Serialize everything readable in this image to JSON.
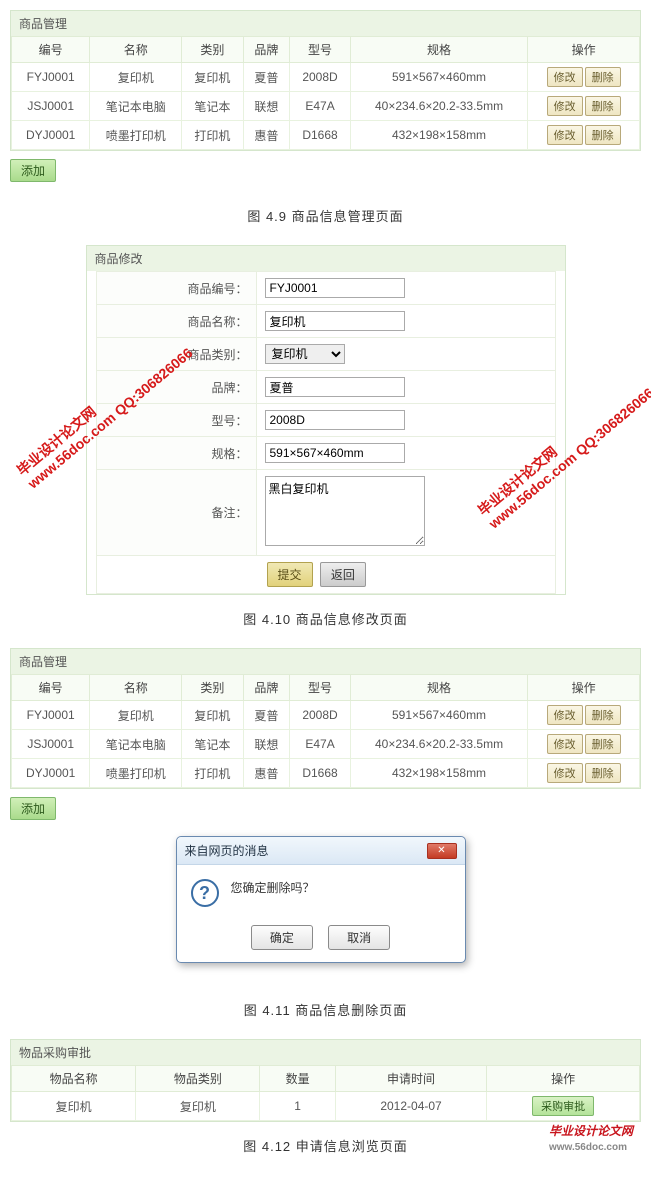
{
  "colors": {
    "border": "#d5e6cc",
    "accent": "#a9db8c",
    "danger": "#c43b24"
  },
  "table1": {
    "title": "商品管理",
    "headers": [
      "编号",
      "名称",
      "类别",
      "品牌",
      "型号",
      "规格",
      "操作"
    ],
    "rows": [
      {
        "no": "FYJ0001",
        "name": "复印机",
        "cat": "复印机",
        "brand": "夏普",
        "model": "2008D",
        "spec": "591×567×460mm"
      },
      {
        "no": "JSJ0001",
        "name": "笔记本电脑",
        "cat": "笔记本",
        "brand": "联想",
        "model": "E47A",
        "spec": "40×234.6×20.2-33.5mm"
      },
      {
        "no": "DYJ0001",
        "name": "喷墨打印机",
        "cat": "打印机",
        "brand": "惠普",
        "model": "D1668",
        "spec": "432×198×158mm"
      }
    ],
    "edit": "修改",
    "del": "删除",
    "add": "添加"
  },
  "caption1": "图 4.9 商品信息管理页面",
  "form": {
    "title": "商品修改",
    "fields": {
      "no_label": "商品编号：",
      "no_value": "FYJ0001",
      "name_label": "商品名称：",
      "name_value": "复印机",
      "cat_label": "商品类别：",
      "cat_value": "复印机",
      "brand_label": "品牌：",
      "brand_value": "夏普",
      "model_label": "型号：",
      "model_value": "2008D",
      "spec_label": "规格：",
      "spec_value": "591×567×460mm",
      "remark_label": "备注：",
      "remark_value": "黑白复印机"
    },
    "submit": "提交",
    "back": "返回"
  },
  "caption2": "图 4.10 商品信息修改页面",
  "table2": {
    "title": "商品管理",
    "headers": [
      "编号",
      "名称",
      "类别",
      "品牌",
      "型号",
      "规格",
      "操作"
    ],
    "rows": [
      {
        "no": "FYJ0001",
        "name": "复印机",
        "cat": "复印机",
        "brand": "夏普",
        "model": "2008D",
        "spec": "591×567×460mm"
      },
      {
        "no": "JSJ0001",
        "name": "笔记本电脑",
        "cat": "笔记本",
        "brand": "联想",
        "model": "E47A",
        "spec": "40×234.6×20.2-33.5mm"
      },
      {
        "no": "DYJ0001",
        "name": "喷墨打印机",
        "cat": "打印机",
        "brand": "惠普",
        "model": "D1668",
        "spec": "432×198×158mm"
      }
    ],
    "edit": "修改",
    "del": "删除",
    "add": "添加"
  },
  "dialog": {
    "title": "来自网页的消息",
    "message": "您确定删除吗？",
    "ok": "确定",
    "cancel": "取消",
    "close": "✕"
  },
  "caption3": "图 4.11 商品信息删除页面",
  "req": {
    "title": "物品采购审批",
    "headers": [
      "物品名称",
      "物品类别",
      "数量",
      "申请时间",
      "操作"
    ],
    "row": {
      "name": "复印机",
      "cat": "复印机",
      "qty": "1",
      "time": "2012-04-07"
    },
    "approve": "采购审批"
  },
  "caption4": "图 4.12 申请信息浏览页面",
  "watermark": {
    "line1": "毕业设计论文网",
    "line2": "www.56doc.com   QQ:306826066"
  },
  "logo": {
    "brand": "毕业设计论文网",
    "url": "www.56doc.com"
  }
}
